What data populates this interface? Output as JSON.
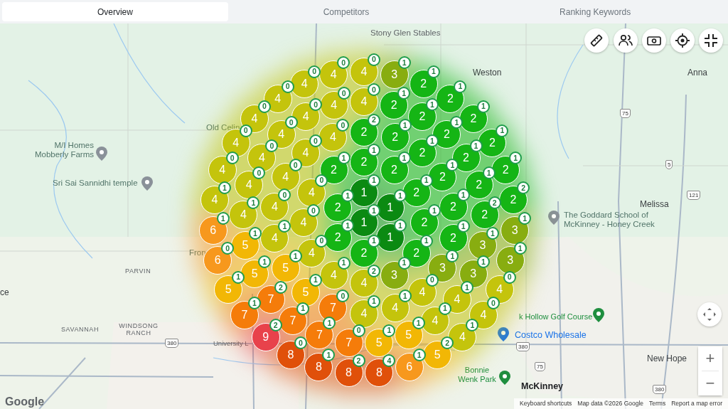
{
  "tabs": [
    {
      "label": "Overview",
      "selected": true
    },
    {
      "label": "Competitors",
      "selected": false
    },
    {
      "label": "Ranking Keywords",
      "selected": false
    }
  ],
  "map": {
    "labels": [
      {
        "text": "Stony Glen Stables",
        "kind": "place"
      },
      {
        "text": "Weston",
        "kind": "town"
      },
      {
        "text": "Anna",
        "kind": "town"
      },
      {
        "text": "Old Celin",
        "kind": "area"
      },
      {
        "text": "M/I Homes Mobberly Farms",
        "kind": "area"
      },
      {
        "text": "Sri Sai Sannidhi temple",
        "kind": "area"
      },
      {
        "text": "Melissa",
        "kind": "town"
      },
      {
        "text": "The Goddard School of McKinney - Honey Creek",
        "kind": "area"
      },
      {
        "text": "PARVIN",
        "kind": "district"
      },
      {
        "text": "SAVANNAH",
        "kind": "district"
      },
      {
        "text": "WINDSONG RANCH",
        "kind": "district"
      },
      {
        "text": "Fron",
        "kind": "area"
      },
      {
        "text": "University L",
        "kind": "place"
      },
      {
        "text": "ce",
        "kind": "town"
      },
      {
        "text": "k Hollow Golf Course",
        "kind": "park"
      },
      {
        "text": "Costco Wholesale",
        "kind": "shop"
      },
      {
        "text": "New Hope",
        "kind": "town"
      },
      {
        "text": "Bonnie Wenk Park",
        "kind": "park"
      },
      {
        "text": "McKinney",
        "kind": "city"
      }
    ],
    "shields": [
      "75",
      "5",
      "121",
      "380",
      "380",
      "75",
      "380"
    ],
    "zoom_in": "+",
    "zoom_out": "−",
    "footer": {
      "logo": "Google",
      "links": [
        "Keyboard shortcuts",
        "Map data ©2026 Google",
        "Terms",
        "Report a map error"
      ]
    }
  },
  "grid": {
    "rings": [
      {
        "right": [
          {
            "rank": "1",
            "badge": "1"
          }
        ]
      },
      {
        "right": [
          {
            "rank": "1",
            "badge": "1"
          },
          {
            "rank": "1",
            "badge": "1"
          },
          {
            "rank": "1",
            "badge": "1"
          },
          {
            "rank": "2",
            "badge": "1"
          }
        ],
        "left": [
          {
            "rank": "2",
            "badge": "1"
          },
          {
            "rank": "2",
            "badge": "1"
          }
        ]
      },
      {
        "right": [
          {
            "rank": "2",
            "badge": "1"
          },
          {
            "rank": "2",
            "badge": "1"
          },
          {
            "rank": "2",
            "badge": "1"
          },
          {
            "rank": "2",
            "badge": "1"
          },
          {
            "rank": "2",
            "badge": "1"
          },
          {
            "rank": "3",
            "badge": "1"
          },
          {
            "rank": "4",
            "badge": "2"
          }
        ],
        "left": [
          {
            "rank": "2",
            "badge": "1"
          },
          {
            "rank": "4",
            "badge": "0"
          },
          {
            "rank": "4",
            "badge": "0"
          },
          {
            "rank": "4",
            "badge": "0"
          },
          {
            "rank": "4",
            "badge": "1"
          }
        ]
      },
      {
        "right": [
          {
            "rank": "2",
            "badge": "2"
          },
          {
            "rank": "2",
            "badge": "1"
          },
          {
            "rank": "2",
            "badge": "1"
          },
          {
            "rank": "2",
            "badge": "1"
          },
          {
            "rank": "2",
            "badge": "1"
          },
          {
            "rank": "2",
            "badge": "1"
          },
          {
            "rank": "3",
            "badge": "1"
          },
          {
            "rank": "4",
            "badge": "0"
          },
          {
            "rank": "4",
            "badge": "1"
          },
          {
            "rank": "4",
            "badge": "1"
          }
        ],
        "left": [
          {
            "rank": "4",
            "badge": "0"
          },
          {
            "rank": "4",
            "badge": "0"
          },
          {
            "rank": "4",
            "badge": "0"
          },
          {
            "rank": "4",
            "badge": "0"
          },
          {
            "rank": "4",
            "badge": "1"
          },
          {
            "rank": "5",
            "badge": "1"
          },
          {
            "rank": "5",
            "badge": "1"
          },
          {
            "rank": "7",
            "badge": "0"
          }
        ]
      },
      {
        "right": [
          {
            "rank": "4",
            "badge": "0"
          },
          {
            "rank": "2",
            "badge": "1"
          },
          {
            "rank": "2",
            "badge": "1"
          },
          {
            "rank": "2",
            "badge": "1"
          },
          {
            "rank": "2",
            "badge": "1"
          },
          {
            "rank": "2",
            "badge": "1"
          },
          {
            "rank": "2",
            "badge": "2"
          },
          {
            "rank": "3",
            "badge": "1"
          },
          {
            "rank": "3",
            "badge": "1"
          },
          {
            "rank": "4",
            "badge": "1"
          },
          {
            "rank": "4",
            "badge": "1"
          },
          {
            "rank": "5",
            "badge": "1"
          },
          {
            "rank": "5",
            "badge": "1"
          }
        ],
        "left": [
          {
            "rank": "4",
            "badge": "0"
          },
          {
            "rank": "4",
            "badge": "0"
          },
          {
            "rank": "4",
            "badge": "0"
          },
          {
            "rank": "4",
            "badge": "0"
          },
          {
            "rank": "4",
            "badge": "0"
          },
          {
            "rank": "4",
            "badge": "1"
          },
          {
            "rank": "5",
            "badge": "1"
          },
          {
            "rank": "5",
            "badge": "1"
          },
          {
            "rank": "7",
            "badge": "2"
          },
          {
            "rank": "7",
            "badge": "1"
          },
          {
            "rank": "7",
            "badge": "1"
          },
          {
            "rank": "7",
            "badge": "0"
          }
        ]
      },
      {
        "right": [
          {
            "rank": "4",
            "badge": "0"
          },
          {
            "rank": "3",
            "badge": "1"
          },
          {
            "rank": "2",
            "badge": "1"
          },
          {
            "rank": "2",
            "badge": "1"
          },
          {
            "rank": "2",
            "badge": "1"
          },
          {
            "rank": "2",
            "badge": "1"
          },
          {
            "rank": "2",
            "badge": "1"
          },
          {
            "rank": "2",
            "badge": "2"
          },
          {
            "rank": "3",
            "badge": "1"
          },
          {
            "rank": "3",
            "badge": "1"
          },
          {
            "rank": "4",
            "badge": "0"
          },
          {
            "rank": "4",
            "badge": "0"
          },
          {
            "rank": "4",
            "badge": "1"
          },
          {
            "rank": "5",
            "badge": "2"
          },
          {
            "rank": "6",
            "badge": "1"
          },
          {
            "rank": "8",
            "badge": "4"
          }
        ],
        "left": [
          {
            "rank": "4",
            "badge": "0"
          },
          {
            "rank": "4",
            "badge": "0"
          },
          {
            "rank": "4",
            "badge": "0"
          },
          {
            "rank": "4",
            "badge": "0"
          },
          {
            "rank": "4",
            "badge": "0"
          },
          {
            "rank": "4",
            "badge": "0"
          },
          {
            "rank": "4",
            "badge": "1"
          },
          {
            "rank": "6",
            "badge": "1"
          },
          {
            "rank": "6",
            "badge": "0"
          },
          {
            "rank": "5",
            "badge": "1"
          },
          {
            "rank": "7",
            "badge": "1"
          },
          {
            "rank": "9",
            "badge": "2"
          },
          {
            "rank": "8",
            "badge": "0"
          },
          {
            "rank": "8",
            "badge": "1"
          },
          {
            "rank": "8",
            "badge": "2"
          }
        ]
      }
    ]
  }
}
